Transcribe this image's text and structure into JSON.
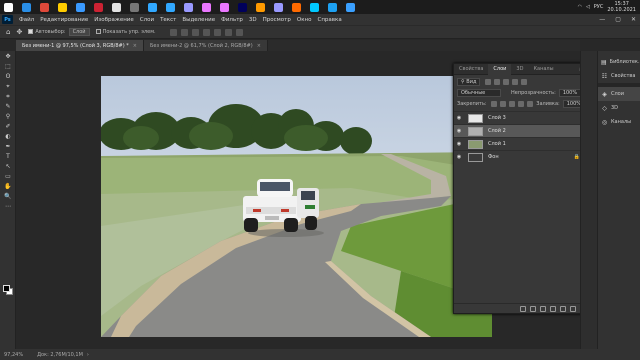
{
  "taskbar": {
    "icons": [
      "#ffffff",
      "#2a8ee6",
      "#e0493a",
      "#ffcc00",
      "#3a9aff",
      "#cc2233",
      "#e2e2e2",
      "#777777",
      "#31a8ff",
      "#31a8ff",
      "#9999ff",
      "#ea77ff",
      "#ea77ff",
      "#00005b",
      "#ff9a00",
      "#9999ff",
      "#ff6a00",
      "#00c8ff",
      "#1da1f2",
      "#3aa0ff"
    ],
    "lang": "РУС",
    "time": "15:37",
    "date": "20.10.2021"
  },
  "menubar": {
    "logo": "Ps",
    "items": [
      "Файл",
      "Редактирование",
      "Изображение",
      "Слои",
      "Текст",
      "Выделение",
      "Фильтр",
      "3D",
      "Просмотр",
      "Окно",
      "Справка"
    ]
  },
  "options": {
    "autoselect_label": "Автовыбор:",
    "autoselect_value": "Слой",
    "transform_label": "Показать упр. элем."
  },
  "tabs": [
    {
      "label": "Без имени-1 @ 97,5% (Слой 3, RGB/8#) *",
      "active": true
    },
    {
      "label": "Без имени-2 @ 61,7% (Слой 2, RGB/8#)",
      "active": false
    }
  ],
  "toolbar": {
    "tools": [
      "✥",
      "⬚",
      "ʘ",
      "⌖",
      "⌗",
      "✎",
      "⚲",
      "✐",
      "◐",
      "✒",
      "T",
      "↖",
      "▭",
      "✋",
      "🔍",
      "⋯"
    ]
  },
  "layers_panel": {
    "tabs": [
      {
        "label": "Свойства",
        "active": false
      },
      {
        "label": "Слои",
        "active": true
      },
      {
        "label": "3D",
        "active": false
      },
      {
        "label": "Каналы",
        "active": false
      }
    ],
    "filter_value": "Вид",
    "blend_mode": "Обычные",
    "opacity_label": "Непрозрачность:",
    "opacity_value": "100%",
    "lock_label": "Закрепить:",
    "fill_label": "Заливка:",
    "fill_value": "100%",
    "layers": [
      {
        "name": "Слой 3",
        "selected": false,
        "thumb": "#e8e8e8",
        "locked": false
      },
      {
        "name": "Слой 2",
        "selected": true,
        "thumb": "#b0b0b0",
        "locked": false
      },
      {
        "name": "Слой 1",
        "selected": false,
        "thumb": "#8a9a70",
        "locked": false
      },
      {
        "name": "Фон",
        "selected": false,
        "thumb": "#3a3a3a",
        "locked": true
      }
    ]
  },
  "dock": {
    "items": [
      {
        "label": "Библиотек...",
        "icon": "▤",
        "active": false
      },
      {
        "label": "Свойства",
        "icon": "☷",
        "active": false
      },
      {
        "label": "Слои",
        "icon": "◈",
        "active": true
      },
      {
        "label": "3D",
        "icon": "◇",
        "active": false
      },
      {
        "label": "Каналы",
        "icon": "◎",
        "active": false
      }
    ]
  },
  "status": {
    "zoom": "97,24%",
    "doc": "Док: 2,76M/10,1M"
  }
}
